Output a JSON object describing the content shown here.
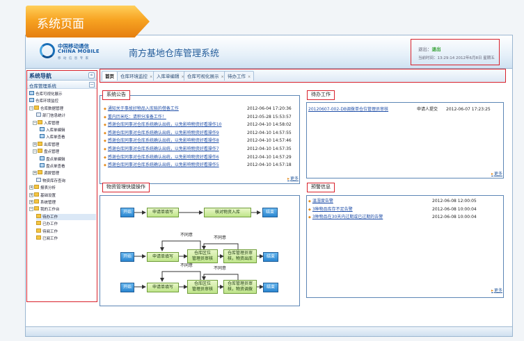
{
  "banner": {
    "label": "系统页面"
  },
  "header": {
    "logo_cn": "中国移动通信",
    "logo_en": "CHINA MOBILE",
    "logo_sub": "移 动 信 息 专 家",
    "title": "南方基地仓库管理系统",
    "user_prefix": "退出：",
    "logout": "退出",
    "login_time": "当前时间：13:29:14 2012年6月8日 星期五"
  },
  "sidebar": {
    "title": "系统导航",
    "collapse": "«",
    "group": "仓库管理系统",
    "group_toggle": "−",
    "items": [
      {
        "label": "仓库可视化展示",
        "indent": 0,
        "toggle": "",
        "icon": "grid"
      },
      {
        "label": "仓库环境监控",
        "indent": 0,
        "toggle": "",
        "icon": "grid"
      },
      {
        "label": "仓库数据管理",
        "indent": 0,
        "toggle": "−",
        "icon": "folder"
      },
      {
        "label": "部门信息统计",
        "indent": 2,
        "toggle": "",
        "icon": "doc"
      },
      {
        "label": "入库管理",
        "indent": 1,
        "toggle": "−",
        "icon": "folder"
      },
      {
        "label": "入库单编辑",
        "indent": 3,
        "toggle": "",
        "icon": "grid"
      },
      {
        "label": "入库单查看",
        "indent": 3,
        "toggle": "",
        "icon": "grid"
      },
      {
        "label": "出库管理",
        "indent": 1,
        "toggle": "+",
        "icon": "folder"
      },
      {
        "label": "盘点管理",
        "indent": 1,
        "toggle": "−",
        "icon": "folder"
      },
      {
        "label": "盘点单编辑",
        "indent": 3,
        "toggle": "",
        "icon": "grid"
      },
      {
        "label": "盘点单查看",
        "indent": 3,
        "toggle": "",
        "icon": "grid"
      },
      {
        "label": "调拨管理",
        "indent": 1,
        "toggle": "+",
        "icon": "folder"
      },
      {
        "label": "物资库存查询",
        "indent": 2,
        "toggle": "",
        "icon": "doc"
      },
      {
        "label": "报表分析",
        "indent": 0,
        "toggle": "+",
        "icon": "folder"
      },
      {
        "label": "基础设置",
        "indent": 0,
        "toggle": "+",
        "icon": "folder"
      },
      {
        "label": "系统管理",
        "indent": 0,
        "toggle": "+",
        "icon": "folder"
      },
      {
        "label": "我的工作台",
        "indent": 0,
        "toggle": "−",
        "icon": "folder"
      },
      {
        "label": "待办工作",
        "indent": 2,
        "toggle": "",
        "icon": "folder",
        "selected": true
      },
      {
        "label": "已办工作",
        "indent": 2,
        "toggle": "",
        "icon": "folder"
      },
      {
        "label": "待阅工作",
        "indent": 2,
        "toggle": "",
        "icon": "folder"
      },
      {
        "label": "已阅工作",
        "indent": 2,
        "toggle": "",
        "icon": "folder"
      }
    ]
  },
  "tabs": [
    {
      "label": "首页",
      "active": true,
      "closable": false
    },
    {
      "label": "仓库环境监控",
      "active": false,
      "closable": true
    },
    {
      "label": "入库单编辑",
      "active": false,
      "closable": true
    },
    {
      "label": "仓库可视化展示",
      "active": false,
      "closable": true
    },
    {
      "label": "待办工作",
      "active": false,
      "closable": true
    }
  ],
  "tab_close": "×",
  "announcements": {
    "title": "系统公告",
    "more": "更多",
    "items": [
      {
        "text": "通知关于事故好物品入库赔的借备工作",
        "date": "2012-06-04 17:20:36"
      },
      {
        "text": "重内历米吃：请积分准备工作！",
        "date": "2012-05-28 15:53:57"
      },
      {
        "text": "感谢仓库同事对仓库系统确认出统，以免影响物资好看操作10",
        "date": "2012-04-10 14:58:02"
      },
      {
        "text": "感谢仓库同事对仓库系统确认出统，以免影响物资好看操作9",
        "date": "2012-04-10 14:57:55"
      },
      {
        "text": "感谢仓库同事对仓库系统确认出统，以免影响物资好看操作8",
        "date": "2012-04-10 14:57:46"
      },
      {
        "text": "感谢仓库同事对仓库系统确认出统，以免影响物资好看操作7",
        "date": "2012-04-10 14:57:35"
      },
      {
        "text": "感谢仓库同事对仓库系统确认出统，以免影响物资好看操作6",
        "date": "2012-04-10 14:57:29"
      },
      {
        "text": "感谢仓库同事对仓库系统确认出统，以免影响物资好看操作5",
        "date": "2012-04-10 14:57:18"
      }
    ]
  },
  "todo": {
    "title": "待办工作",
    "more": "更多",
    "items": [
      {
        "text": "20120607-002-DB调拨单仓位管理员审核",
        "submitter": "申请人提交",
        "date": "2012-06-07 17:23:25"
      }
    ]
  },
  "flow": {
    "title": "物资管理快捷操作",
    "start": "开始",
    "end": "结束",
    "fill_form": "申请单填写",
    "check_in": "核对物资入库",
    "not_agree": "不同意",
    "dept_review": "仓库区位\n管理员审核",
    "mgr_review": "仓库管理员审\n核，物资出库",
    "mgr_review2": "仓库管理员审\n核，物资调拨"
  },
  "warnings": {
    "title": "预警信息",
    "more": "更多",
    "items": [
      {
        "text": "温湿度告警",
        "date": "2012-06-08 12:00:05"
      },
      {
        "text": "3种物品库存不足告警",
        "date": "2012-06-08 10:00:04"
      },
      {
        "text": "3种物品在30天内过期或已过期的告警",
        "date": "2012-06-08 10:00:04"
      }
    ]
  }
}
